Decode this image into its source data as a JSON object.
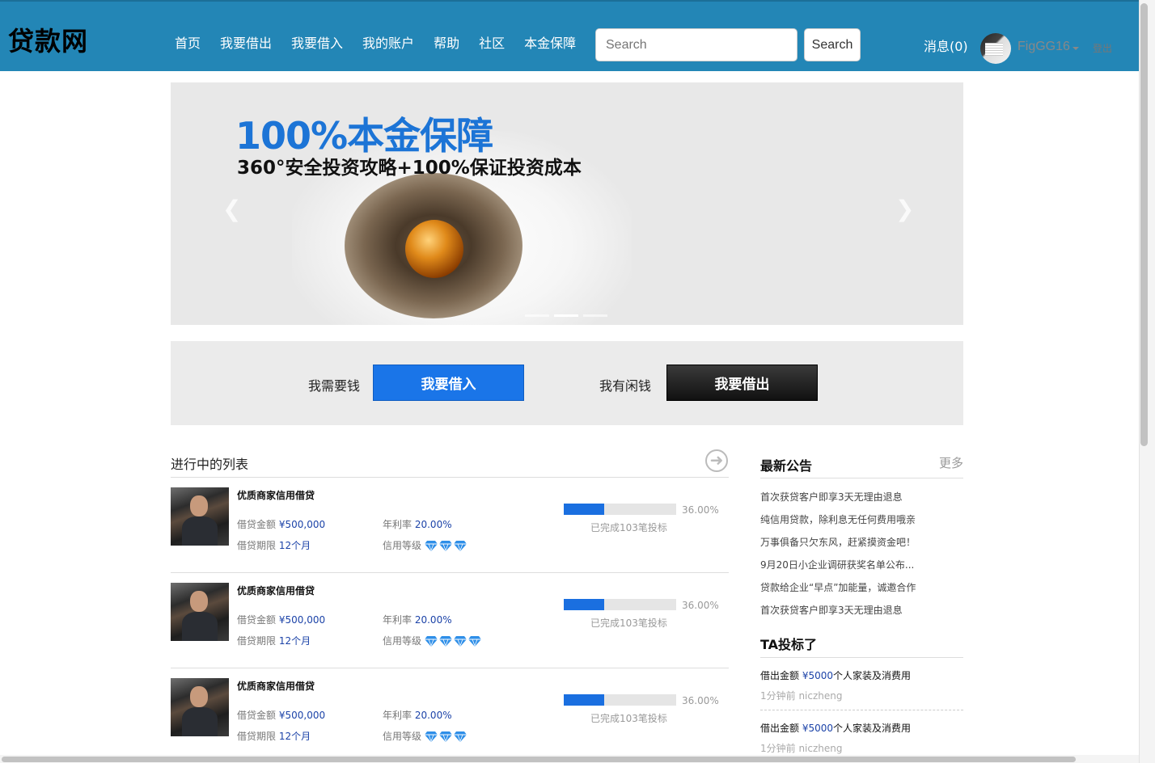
{
  "header": {
    "logo": "贷款网",
    "nav": [
      "首页",
      "我要借出",
      "我要借入",
      "我的账户",
      "帮助",
      "社区",
      "本金保障"
    ],
    "search_placeholder": "Search",
    "search_button": "Search",
    "messages": "消息(0)",
    "username": "FigGG16",
    "logout": "登出"
  },
  "carousel": {
    "title": "100%本金保障",
    "subtitle": "360°安全投资攻略+100%保证投资成本",
    "prev_icon": "chevron-left-icon",
    "next_icon": "chevron-right-icon",
    "slide_count": 3,
    "active_slide": 2
  },
  "actions": {
    "need_money": "我需要钱",
    "borrow_button": "我要借入",
    "have_money": "我有闲钱",
    "lend_button": "我要借出"
  },
  "list": {
    "title": "进行中的列表",
    "items": [
      {
        "name": "优质商家信用借贷",
        "amount_label": "借贷金额",
        "amount": "¥500,000",
        "rate_label": "年利率",
        "rate": "20.00%",
        "term_label": "借贷期限",
        "term": "12个月",
        "credit_label": "信用等级",
        "credit_gems": 3,
        "progress": 0.36,
        "progress_text": "36.00%",
        "note": "已完成103笔投标"
      },
      {
        "name": "优质商家信用借贷",
        "amount_label": "借贷金额",
        "amount": "¥500,000",
        "rate_label": "年利率",
        "rate": "20.00%",
        "term_label": "借贷期限",
        "term": "12个月",
        "credit_label": "信用等级",
        "credit_gems": 4,
        "progress": 0.36,
        "progress_text": "36.00%",
        "note": "已完成103笔投标"
      },
      {
        "name": "优质商家信用借贷",
        "amount_label": "借贷金额",
        "amount": "¥500,000",
        "rate_label": "年利率",
        "rate": "20.00%",
        "term_label": "借贷期限",
        "term": "12个月",
        "credit_label": "信用等级",
        "credit_gems": 3,
        "progress": 0.36,
        "progress_text": "36.00%",
        "note": "已完成103笔投标"
      }
    ]
  },
  "sidebar": {
    "notices_title": "最新公告",
    "more": "更多",
    "notices": [
      "首次获贷客户即享3天无理由退息",
      "纯信用贷款，除利息无任何费用哦亲",
      "万事俱备只欠东风，赶紧摸资金吧！",
      "9月20日小企业调研获奖名单公布...",
      "贷款给企业“早点”加能量，诚邀合作",
      "首次获贷客户即享3天无理由退息"
    ],
    "bids_title": "TA投标了",
    "bids": [
      {
        "label": "借出金额",
        "amount": "¥5000",
        "purpose": "个人家装及消费用",
        "meta": "1分钟前 niczheng"
      },
      {
        "label": "借出金额",
        "amount": "¥5000",
        "purpose": "个人家装及消费用",
        "meta": "1分钟前 niczheng"
      }
    ]
  },
  "colors": {
    "topbar": "#2386b6",
    "accent_blue": "#1a75e8",
    "link_blue": "#1c43a8",
    "gem_blue": "#2f8fe8"
  }
}
